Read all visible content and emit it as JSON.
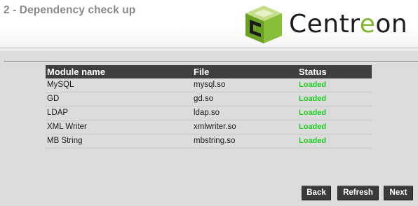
{
  "header": {
    "step_title": "2 - Dependency check up",
    "logo": {
      "name": "centreon-logo",
      "text_part1": "Centr",
      "text_accent": "e",
      "text_part2": "on",
      "brand_green": "#7fb62d"
    }
  },
  "table": {
    "columns": [
      "Module name",
      "File",
      "Status"
    ],
    "rows": [
      {
        "module": "MySQL",
        "file": "mysql.so",
        "status": "Loaded"
      },
      {
        "module": "GD",
        "file": "gd.so",
        "status": "Loaded"
      },
      {
        "module": "LDAP",
        "file": "ldap.so",
        "status": "Loaded"
      },
      {
        "module": "XML Writer",
        "file": "xmlwriter.so",
        "status": "Loaded"
      },
      {
        "module": "MB String",
        "file": "mbstring.so",
        "status": "Loaded"
      }
    ],
    "status_color": "#22cc22"
  },
  "buttons": {
    "back": "Back",
    "refresh": "Refresh",
    "next": "Next"
  }
}
